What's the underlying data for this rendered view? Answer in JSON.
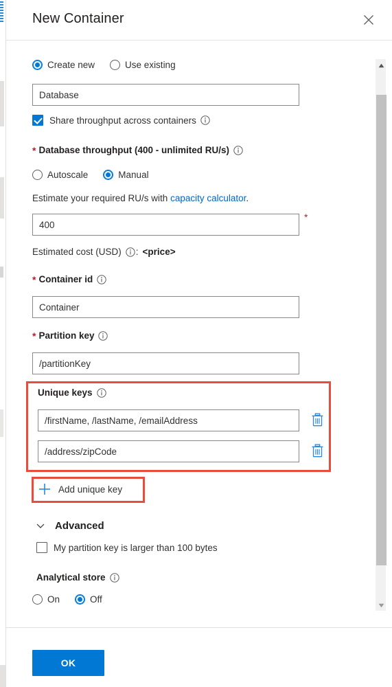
{
  "panel": {
    "title": "New Container",
    "close_icon": "close-icon"
  },
  "database_mode": {
    "options": [
      {
        "label": "Create new",
        "selected": true
      },
      {
        "label": "Use existing",
        "selected": false
      }
    ]
  },
  "database_id": {
    "value": "Database"
  },
  "share_throughput": {
    "label": "Share throughput across containers",
    "checked": true
  },
  "throughput": {
    "label": "Database throughput (400 - unlimited RU/s)",
    "required": true,
    "modes": [
      {
        "label": "Autoscale",
        "selected": false
      },
      {
        "label": "Manual",
        "selected": true
      }
    ],
    "estimate_prefix": "Estimate your required RU/s with ",
    "estimate_link": "capacity calculator",
    "estimate_suffix": ".",
    "value": "400",
    "required_mark": "*"
  },
  "estimated_cost": {
    "label": "Estimated cost (USD)",
    "separator": ":",
    "value": "<price>"
  },
  "container_id": {
    "label": "Container id",
    "required": true,
    "value": "Container"
  },
  "partition_key": {
    "label": "Partition key",
    "required": true,
    "value": "/partitionKey"
  },
  "unique_keys": {
    "label": "Unique keys",
    "highlighted": true,
    "highlight_color": "#e74c3c",
    "rows": [
      {
        "value": "/firstName, /lastName, /emailAddress",
        "delete_icon": "trash-icon"
      },
      {
        "value": "/address/zipCode",
        "delete_icon": "trash-icon"
      }
    ],
    "add_button": {
      "label": "Add unique key",
      "icon": "plus-icon",
      "highlighted": true
    }
  },
  "advanced": {
    "label": "Advanced",
    "chevron_icon": "chevron-down-icon",
    "large_partition_key": {
      "label": "My partition key is larger than 100 bytes",
      "checked": false
    }
  },
  "analytical_store": {
    "label": "Analytical store",
    "options": [
      {
        "label": "On",
        "selected": false
      },
      {
        "label": "Off",
        "selected": true
      }
    ]
  },
  "footer": {
    "ok_label": "OK"
  },
  "scrollbar": {
    "up_icon": "chevron-up-icon",
    "down_icon": "chevron-down-icon"
  },
  "colors": {
    "accent": "#0078d4",
    "required": "#a4262c",
    "link": "#0066cc",
    "highlight": "#e74c3c"
  }
}
